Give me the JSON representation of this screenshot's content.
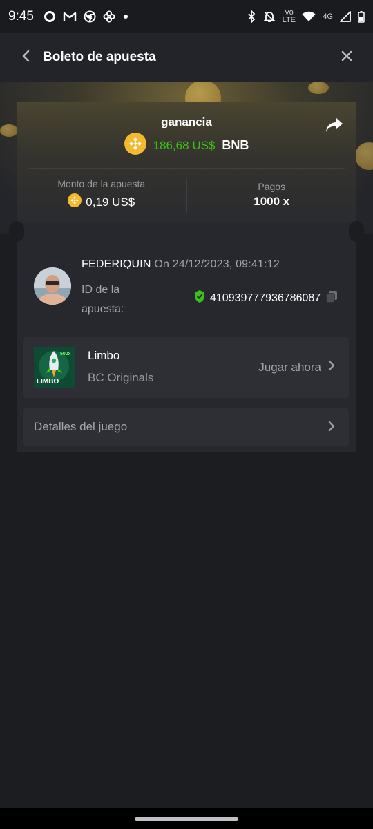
{
  "status_bar": {
    "time": "9:45",
    "network_label": "4G",
    "volte_label": "Vo LTE",
    "notification_icons": [
      "circle-icon",
      "gmail-icon",
      "chrome-icon",
      "pinwheel-icon",
      "dot-icon"
    ],
    "system_icons": [
      "bluetooth-icon",
      "bell-off-icon",
      "volte-icon",
      "wifi-icon",
      "signal-icon",
      "battery-icon"
    ]
  },
  "header": {
    "title": "Boleto de apuesta"
  },
  "ticket": {
    "win_label": "ganancia",
    "win_amount": "186,68 US$",
    "win_currency": "BNB",
    "bet_amount_label": "Monto de la apuesta",
    "bet_amount": "0,19 US$",
    "payout_label": "Pagos",
    "payout_value": "1000 x",
    "colors": {
      "win_green": "#3bc117",
      "bnb_gold": "#f3ba2f"
    }
  },
  "player": {
    "name": "FEDERIQUIN",
    "date": "On 24/12/2023, 09:41:12",
    "bet_id_label": "ID de la apuesta:",
    "bet_id": "410939777936786087"
  },
  "game": {
    "name": "Limbo",
    "provider": "BC Originals",
    "play_label": "Jugar ahora",
    "thumb_text": "LIMBO",
    "thumb_multiplier": "500x"
  },
  "details": {
    "label": "Detalles del juego"
  }
}
